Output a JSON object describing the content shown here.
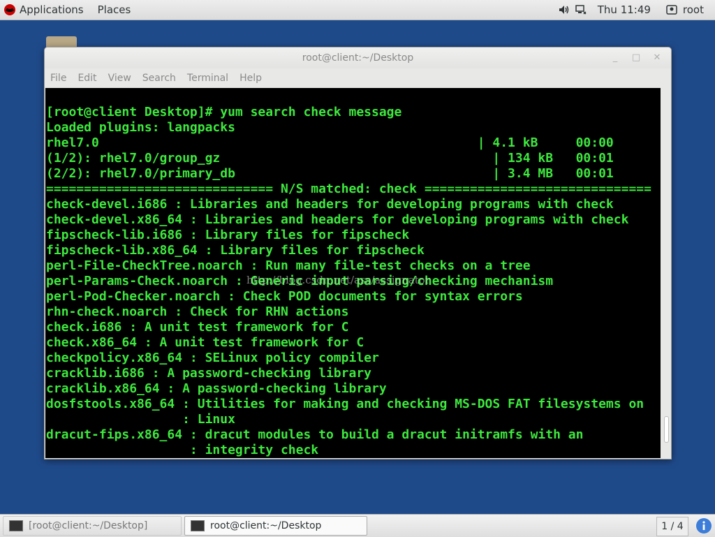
{
  "top_panel": {
    "applications_label": "Applications",
    "places_label": "Places",
    "clock": "Thu 11:49",
    "user": "root"
  },
  "window": {
    "title": "root@client:~/Desktop",
    "controls": {
      "minimize": "_",
      "maximize": "□",
      "close": "✕"
    },
    "menu": [
      "File",
      "Edit",
      "View",
      "Search",
      "Terminal",
      "Help"
    ]
  },
  "terminal": {
    "lines": [
      "[root@client Desktop]# yum search check message",
      "Loaded plugins: langpacks",
      "rhel7.0                                                  | 4.1 kB     00:00",
      "(1/2): rhel7.0/group_gz                                    | 134 kB   00:01",
      "(2/2): rhel7.0/primary_db                                  | 3.4 MB   00:01",
      "============================== N/S matched: check ==============================",
      "check-devel.i686 : Libraries and headers for developing programs with check",
      "check-devel.x86_64 : Libraries and headers for developing programs with check",
      "fipscheck-lib.i686 : Library files for fipscheck",
      "fipscheck-lib.x86_64 : Library files for fipscheck",
      "perl-File-CheckTree.noarch : Run many file-test checks on a tree",
      "perl-Params-Check.noarch : Generic input parsing/checking mechanism",
      "perl-Pod-Checker.noarch : Check POD documents for syntax errors",
      "rhn-check.noarch : Check for RHN actions",
      "check.i686 : A unit test framework for C",
      "check.x86_64 : A unit test framework for C",
      "checkpolicy.x86_64 : SELinux policy compiler",
      "cracklib.i686 : A password-checking library",
      "cracklib.x86_64 : A password-checking library",
      "dosfstools.x86_64 : Utilities for making and checking MS-DOS FAT filesystems on",
      "                  : Linux",
      "dracut-fips.x86_64 : dracut modules to build a dracut initramfs with an",
      "                   : integrity check"
    ],
    "watermark": "http://blog.csdn.net/ass/assignator",
    "text_color": "#3ee83e",
    "background_color": "#000000"
  },
  "taskbar": {
    "tasks": [
      "[root@client:~/Desktop]",
      "root@client:~/Desktop"
    ],
    "workspace": "1 / 4"
  },
  "icons": {
    "applications": "redhat-icon",
    "volume": "speaker-icon",
    "network": "network-icon",
    "user": "user-icon",
    "terminal": "terminal-icon",
    "notifications": "info-icon"
  }
}
